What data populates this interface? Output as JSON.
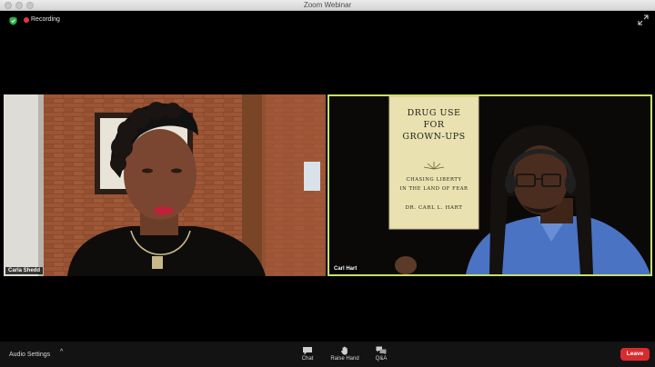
{
  "window": {
    "title": "Zoom Webinar"
  },
  "status": {
    "recording_label": "Recording"
  },
  "participants": [
    {
      "name": "Carla Shedd"
    },
    {
      "name": "Carl Hart"
    }
  ],
  "book": {
    "title_line1": "DRUG USE",
    "title_line2": "FOR",
    "title_line3": "GROWN-UPS",
    "subtitle_line1": "CHASING LIBERTY",
    "subtitle_line2": "IN THE LAND OF FEAR",
    "author": "DR. CARL L. HART"
  },
  "toolbar": {
    "audio_settings_label": "Audio Settings",
    "audio_caret": "^",
    "chat_label": "Chat",
    "raise_hand_label": "Raise Hand",
    "qa_label": "Q&A",
    "leave_label": "Leave"
  },
  "colors": {
    "active_speaker_border": "#c9e06a",
    "recording_dot": "#e0393e",
    "leave_button": "#d72c2f",
    "security_shield": "#2bb24c"
  }
}
